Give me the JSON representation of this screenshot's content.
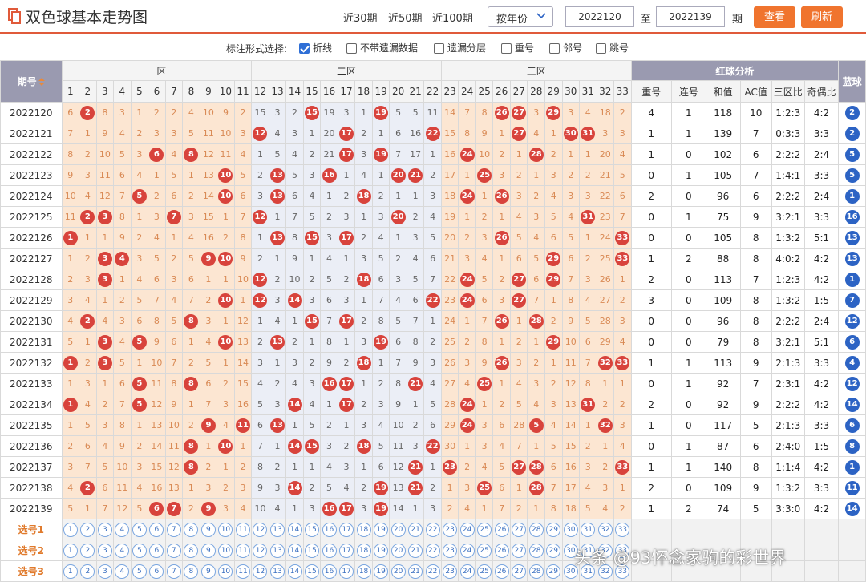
{
  "header": {
    "title": "双色球基本走势图",
    "period_links": [
      "近30期",
      "近50期",
      "近100期"
    ],
    "range_select": "按年份",
    "from_issue": "2022120",
    "to_label": "至",
    "to_issue": "2022139",
    "unit_label": "期",
    "query_button": "查看",
    "refresh_button": "刷新"
  },
  "options": {
    "label": "标注形式选择:",
    "items": [
      {
        "label": "折线",
        "checked": true
      },
      {
        "label": "不带遗漏数据",
        "checked": false
      },
      {
        "label": "遗漏分层",
        "checked": false
      },
      {
        "label": "重号",
        "checked": false
      },
      {
        "label": "邻号",
        "checked": false
      },
      {
        "label": "跳号",
        "checked": false
      }
    ]
  },
  "table": {
    "issue_header": "期号",
    "zones": [
      "一区",
      "二区",
      "三区"
    ],
    "analysis_header": "红球分析",
    "blue_header": "蓝球",
    "analysis_columns": [
      "重号",
      "连号",
      "和值",
      "AC值",
      "三区比",
      "奇偶比"
    ],
    "pick_rows": [
      "选号1",
      "选号2",
      "选号3"
    ],
    "rows": [
      {
        "issue": "2022120",
        "red": [
          6,
          2,
          8,
          3,
          1,
          2,
          2,
          4,
          10,
          9,
          2,
          15,
          3,
          2,
          15,
          19,
          3,
          1,
          19,
          5,
          5,
          11,
          14,
          7,
          8,
          26,
          27,
          3,
          29,
          3,
          4,
          18,
          2
        ],
        "hits": [
          2,
          15,
          19,
          26,
          27,
          29
        ],
        "analysis": [
          "4",
          "1",
          "118",
          "10",
          "1:2:3",
          "4:2"
        ],
        "blue": 2
      },
      {
        "issue": "2022121",
        "red": [
          7,
          1,
          9,
          4,
          2,
          3,
          3,
          5,
          11,
          10,
          3,
          12,
          4,
          3,
          1,
          20,
          17,
          2,
          1,
          6,
          16,
          22,
          15,
          8,
          9,
          1,
          27,
          4,
          1,
          30,
          31,
          3,
          3
        ],
        "hits": [
          12,
          17,
          22,
          27,
          30,
          31
        ],
        "analysis": [
          "1",
          "1",
          "139",
          "7",
          "0:3:3",
          "3:3"
        ],
        "blue": 2
      },
      {
        "issue": "2022122",
        "red": [
          8,
          2,
          10,
          5,
          3,
          6,
          4,
          8,
          12,
          11,
          4,
          1,
          5,
          4,
          2,
          21,
          17,
          3,
          19,
          7,
          17,
          1,
          16,
          24,
          10,
          2,
          1,
          28,
          2,
          1,
          1,
          20,
          4
        ],
        "hits": [
          6,
          8,
          17,
          19,
          24,
          28
        ],
        "analysis": [
          "1",
          "0",
          "102",
          "6",
          "2:2:2",
          "2:4"
        ],
        "blue": 5
      },
      {
        "issue": "2022123",
        "red": [
          9,
          3,
          11,
          6,
          4,
          1,
          5,
          1,
          13,
          10,
          5,
          2,
          13,
          5,
          3,
          16,
          1,
          4,
          1,
          20,
          21,
          2,
          17,
          1,
          25,
          3,
          2,
          1,
          3,
          2,
          2,
          21,
          5
        ],
        "hits": [
          10,
          13,
          16,
          20,
          21,
          25
        ],
        "analysis": [
          "0",
          "1",
          "105",
          "7",
          "1:4:1",
          "3:3"
        ],
        "blue": 5
      },
      {
        "issue": "2022124",
        "red": [
          10,
          4,
          12,
          7,
          5,
          2,
          6,
          2,
          14,
          10,
          6,
          3,
          13,
          6,
          4,
          1,
          2,
          18,
          2,
          1,
          1,
          3,
          18,
          24,
          1,
          26,
          3,
          2,
          4,
          3,
          3,
          22,
          6
        ],
        "hits": [
          5,
          10,
          13,
          18,
          24,
          26
        ],
        "analysis": [
          "2",
          "0",
          "96",
          "6",
          "2:2:2",
          "2:4"
        ],
        "blue": 1
      },
      {
        "issue": "2022125",
        "red": [
          11,
          2,
          3,
          8,
          1,
          3,
          7,
          3,
          15,
          1,
          7,
          12,
          1,
          7,
          5,
          2,
          3,
          1,
          3,
          20,
          2,
          4,
          19,
          1,
          2,
          1,
          4,
          3,
          5,
          4,
          31,
          23,
          7
        ],
        "hits": [
          2,
          3,
          7,
          12,
          20,
          31
        ],
        "analysis": [
          "0",
          "1",
          "75",
          "9",
          "3:2:1",
          "3:3"
        ],
        "blue": 16
      },
      {
        "issue": "2022126",
        "red": [
          1,
          1,
          1,
          9,
          2,
          4,
          1,
          4,
          16,
          2,
          8,
          1,
          13,
          8,
          15,
          3,
          17,
          2,
          4,
          1,
          3,
          5,
          20,
          2,
          3,
          26,
          5,
          4,
          6,
          5,
          1,
          24,
          33
        ],
        "hits": [
          1,
          13,
          15,
          17,
          26,
          33
        ],
        "analysis": [
          "0",
          "0",
          "105",
          "8",
          "1:3:2",
          "5:1"
        ],
        "blue": 13
      },
      {
        "issue": "2022127",
        "red": [
          1,
          2,
          3,
          4,
          3,
          5,
          2,
          5,
          9,
          10,
          9,
          2,
          1,
          9,
          1,
          4,
          1,
          3,
          5,
          2,
          4,
          6,
          21,
          3,
          4,
          1,
          6,
          5,
          29,
          6,
          2,
          25,
          33
        ],
        "hits": [
          3,
          4,
          9,
          10,
          29,
          33
        ],
        "analysis": [
          "1",
          "2",
          "88",
          "8",
          "4:0:2",
          "4:2"
        ],
        "blue": 13
      },
      {
        "issue": "2022128",
        "red": [
          2,
          3,
          3,
          1,
          4,
          6,
          3,
          6,
          1,
          1,
          10,
          12,
          2,
          10,
          2,
          5,
          2,
          18,
          6,
          3,
          5,
          7,
          22,
          24,
          5,
          2,
          27,
          6,
          29,
          7,
          3,
          26,
          1
        ],
        "hits": [
          3,
          12,
          18,
          24,
          27,
          29
        ],
        "analysis": [
          "2",
          "0",
          "113",
          "7",
          "1:2:3",
          "4:2"
        ],
        "blue": 1
      },
      {
        "issue": "2022129",
        "red": [
          3,
          4,
          1,
          2,
          5,
          7,
          4,
          7,
          2,
          10,
          1,
          12,
          3,
          14,
          3,
          6,
          3,
          1,
          7,
          4,
          6,
          22,
          23,
          24,
          6,
          3,
          27,
          7,
          1,
          8,
          4,
          27,
          2
        ],
        "hits": [
          10,
          12,
          14,
          22,
          24,
          27
        ],
        "analysis": [
          "3",
          "0",
          "109",
          "8",
          "1:3:2",
          "1:5"
        ],
        "blue": 7
      },
      {
        "issue": "2022130",
        "red": [
          4,
          2,
          4,
          3,
          6,
          8,
          5,
          8,
          3,
          1,
          12,
          1,
          4,
          1,
          15,
          7,
          17,
          2,
          8,
          5,
          7,
          1,
          24,
          1,
          7,
          26,
          1,
          28,
          2,
          9,
          5,
          28,
          3
        ],
        "hits": [
          2,
          8,
          15,
          17,
          26,
          28
        ],
        "analysis": [
          "0",
          "0",
          "96",
          "8",
          "2:2:2",
          "2:4"
        ],
        "blue": 12
      },
      {
        "issue": "2022131",
        "red": [
          5,
          1,
          3,
          4,
          5,
          9,
          6,
          1,
          4,
          10,
          13,
          2,
          13,
          2,
          1,
          8,
          1,
          3,
          19,
          6,
          8,
          2,
          25,
          2,
          8,
          1,
          2,
          1,
          29,
          10,
          6,
          29,
          4
        ],
        "hits": [
          3,
          5,
          10,
          13,
          19,
          29
        ],
        "analysis": [
          "0",
          "0",
          "79",
          "8",
          "3:2:1",
          "5:1"
        ],
        "blue": 6
      },
      {
        "issue": "2022132",
        "red": [
          1,
          2,
          3,
          5,
          1,
          10,
          7,
          2,
          5,
          1,
          14,
          3,
          1,
          3,
          2,
          9,
          2,
          18,
          1,
          7,
          9,
          3,
          26,
          3,
          9,
          26,
          3,
          2,
          1,
          11,
          7,
          32,
          33
        ],
        "hits": [
          1,
          3,
          18,
          26,
          32,
          33
        ],
        "analysis": [
          "1",
          "1",
          "113",
          "9",
          "2:1:3",
          "3:3"
        ],
        "blue": 4
      },
      {
        "issue": "2022133",
        "red": [
          1,
          3,
          1,
          6,
          5,
          11,
          8,
          8,
          6,
          2,
          15,
          4,
          2,
          4,
          3,
          16,
          17,
          1,
          2,
          8,
          21,
          4,
          27,
          4,
          25,
          1,
          4,
          3,
          2,
          12,
          8,
          1,
          1
        ],
        "hits": [
          5,
          8,
          16,
          17,
          21,
          25
        ],
        "analysis": [
          "0",
          "1",
          "92",
          "7",
          "2:3:1",
          "4:2"
        ],
        "blue": 12
      },
      {
        "issue": "2022134",
        "red": [
          1,
          4,
          2,
          7,
          5,
          12,
          9,
          1,
          7,
          3,
          16,
          5,
          3,
          14,
          4,
          1,
          17,
          2,
          3,
          9,
          1,
          5,
          28,
          24,
          1,
          2,
          5,
          4,
          3,
          13,
          31,
          2,
          2
        ],
        "hits": [
          1,
          5,
          14,
          17,
          24,
          31
        ],
        "analysis": [
          "2",
          "0",
          "92",
          "9",
          "2:2:2",
          "4:2"
        ],
        "blue": 14
      },
      {
        "issue": "2022135",
        "red": [
          1,
          5,
          3,
          8,
          1,
          13,
          10,
          2,
          9,
          4,
          11,
          6,
          13,
          1,
          5,
          2,
          1,
          3,
          4,
          10,
          2,
          6,
          29,
          24,
          3,
          6,
          28,
          5,
          4,
          14,
          1,
          32,
          3
        ],
        "hits": [
          9,
          11,
          13,
          24,
          28,
          32
        ],
        "analysis": [
          "1",
          "0",
          "117",
          "5",
          "2:1:3",
          "3:3"
        ],
        "blue": 6
      },
      {
        "issue": "2022136",
        "red": [
          2,
          6,
          4,
          9,
          2,
          14,
          11,
          8,
          1,
          10,
          1,
          7,
          1,
          14,
          15,
          3,
          2,
          18,
          5,
          11,
          3,
          22,
          30,
          1,
          3,
          4,
          7,
          1,
          5,
          15,
          2,
          1,
          4
        ],
        "hits": [
          8,
          10,
          14,
          15,
          18,
          22
        ],
        "analysis": [
          "0",
          "1",
          "87",
          "6",
          "2:4:0",
          "1:5"
        ],
        "blue": 8
      },
      {
        "issue": "2022137",
        "red": [
          3,
          7,
          5,
          10,
          3,
          15,
          12,
          8,
          2,
          1,
          2,
          8,
          2,
          1,
          1,
          4,
          3,
          1,
          6,
          12,
          21,
          1,
          23,
          2,
          4,
          5,
          27,
          28,
          6,
          16,
          3,
          2,
          33
        ],
        "hits": [
          8,
          21,
          23,
          27,
          28,
          33
        ],
        "analysis": [
          "1",
          "1",
          "140",
          "8",
          "1:1:4",
          "4:2"
        ],
        "blue": 1
      },
      {
        "issue": "2022138",
        "red": [
          4,
          2,
          6,
          11,
          4,
          16,
          13,
          1,
          3,
          2,
          3,
          9,
          3,
          14,
          2,
          5,
          4,
          2,
          19,
          13,
          21,
          2,
          1,
          3,
          25,
          6,
          1,
          28,
          7,
          17,
          4,
          3,
          1
        ],
        "hits": [
          2,
          14,
          19,
          21,
          25,
          28
        ],
        "analysis": [
          "2",
          "0",
          "109",
          "9",
          "1:3:2",
          "3:3"
        ],
        "blue": 11
      },
      {
        "issue": "2022139",
        "red": [
          5,
          1,
          7,
          12,
          5,
          6,
          7,
          2,
          9,
          3,
          4,
          10,
          4,
          1,
          3,
          16,
          17,
          3,
          19,
          14,
          1,
          3,
          2,
          4,
          1,
          7,
          2,
          1,
          8,
          18,
          5,
          4,
          2
        ],
        "hits": [
          6,
          7,
          9,
          16,
          17,
          19
        ],
        "analysis": [
          "1",
          "2",
          "74",
          "5",
          "3:3:0",
          "4:2"
        ],
        "blue": 14
      }
    ]
  },
  "watermark": "头条 @93怀念家驹的彩世界",
  "colors": {
    "accent": "#f0742e",
    "red_ball": "#d8433c",
    "blue_ball": "#2c63c4",
    "header_bg": "#9a9ab0"
  }
}
